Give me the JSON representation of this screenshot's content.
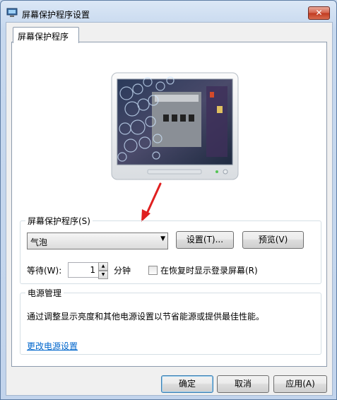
{
  "window": {
    "title": "屏幕保护程序设置",
    "close_glyph": "✕"
  },
  "tabs": [
    {
      "label": "屏幕保护程序"
    }
  ],
  "screensaver_group": {
    "label": "屏幕保护程序(S)",
    "selected": "气泡",
    "settings_button": "设置(T)...",
    "preview_button": "预览(V)",
    "wait_label": "等待(W):",
    "wait_value": "1",
    "wait_unit": "分钟",
    "resume_checkbox_label": "在恢复时显示登录屏幕(R)",
    "resume_checked": false
  },
  "power_group": {
    "label": "电源管理",
    "description": "通过调整显示亮度和其他电源设置以节省能源或提供最佳性能。",
    "link": "更改电源设置"
  },
  "footer": {
    "ok": "确定",
    "cancel": "取消",
    "apply": "应用(A)"
  },
  "colors": {
    "annotation_arrow": "#e02020",
    "link": "#0066cc",
    "close_button": "#c0391f"
  }
}
